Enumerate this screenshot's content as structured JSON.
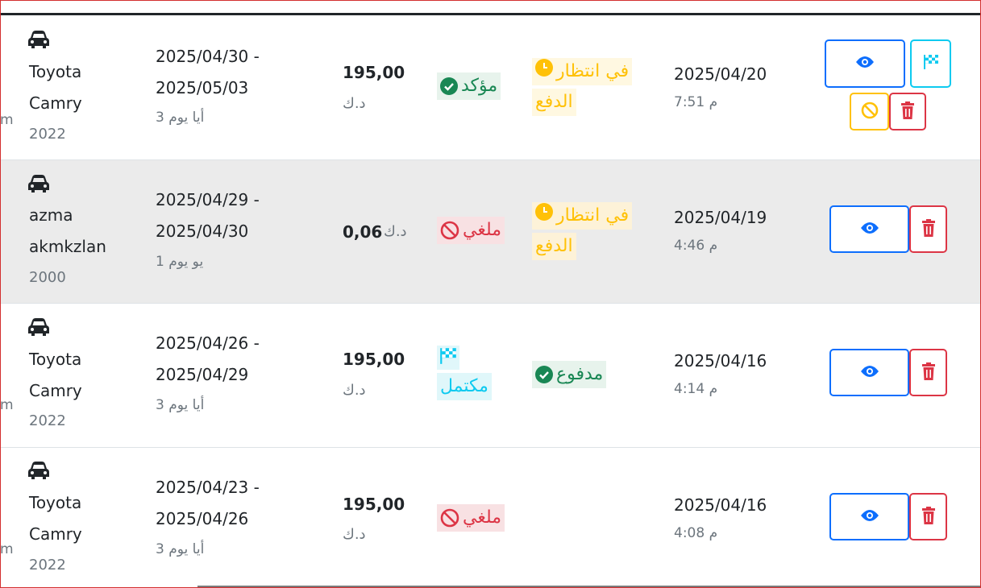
{
  "colors": {
    "success": "#198754",
    "danger": "#dc3545",
    "warning": "#ffc107",
    "info": "#0dcaf0",
    "primary": "#0d6efd"
  },
  "rows": [
    {
      "cut_text": "m",
      "vehicle_line1": "Toyota",
      "vehicle_line2": "Camry",
      "year": "2022",
      "date_range": "2025/04/30 - 2025/05/03",
      "duration": "أيا يوم 3",
      "amount": "195,00",
      "currency": "د.ك",
      "status": "مؤكد",
      "status_icon": "check-circle-icon",
      "payment_line1": "في انتظار",
      "payment_line2": "الدفع",
      "payment_icon": "clock-icon",
      "created_date": "2025/04/20",
      "created_time": "م 7:51",
      "actions": [
        "view-icon",
        "flag-icon",
        "ban-icon",
        "trash-icon"
      ]
    },
    {
      "cut_text": "",
      "vehicle_line1": "azma",
      "vehicle_line2": "akmkzlan",
      "year": "2000",
      "date_range": "2025/04/29 - 2025/04/30",
      "duration": "يو يوم 1",
      "amount": "0,06",
      "currency": "د.ك",
      "status": "ملغي",
      "status_icon": "ban-icon",
      "payment_line1": "في انتظار",
      "payment_line2": "الدفع",
      "payment_icon": "clock-icon",
      "created_date": "2025/04/19",
      "created_time": "م 4:46",
      "actions": [
        "view-icon",
        "trash-icon"
      ]
    },
    {
      "cut_text": "m",
      "vehicle_line1": "Toyota",
      "vehicle_line2": "Camry",
      "year": "2022",
      "date_range": "2025/04/26 - 2025/04/29",
      "duration": "أيا يوم 3",
      "amount": "195,00",
      "currency": "د.ك",
      "status": "مكتمل",
      "status_icon": "flag-icon",
      "payment": "مدفوع",
      "payment_icon": "check-circle-icon",
      "created_date": "2025/04/16",
      "created_time": "م 4:14",
      "actions": [
        "view-icon",
        "trash-icon"
      ]
    },
    {
      "cut_text": "m",
      "vehicle_line1": "Toyota",
      "vehicle_line2": "Camry",
      "year": "2022",
      "date_range": "2025/04/23 - 2025/04/26",
      "duration": "أيا يوم 3",
      "amount": "195,00",
      "currency": "د.ك",
      "status": "ملغي",
      "status_icon": "ban-icon",
      "created_date": "2025/04/16",
      "created_time": "م 4:08",
      "actions": [
        "view-icon",
        "trash-icon"
      ]
    }
  ]
}
